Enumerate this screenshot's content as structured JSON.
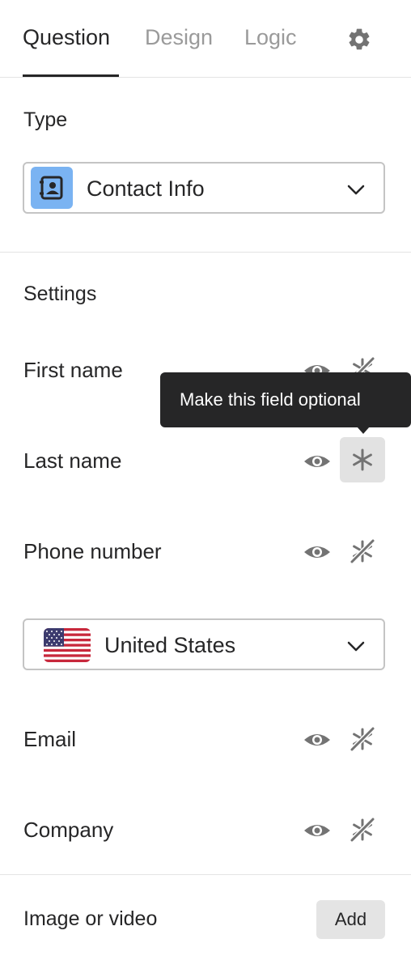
{
  "tabs": [
    {
      "label": "Question",
      "active": true
    },
    {
      "label": "Design",
      "active": false
    },
    {
      "label": "Logic",
      "active": false
    }
  ],
  "type_section": {
    "title": "Type",
    "selected": "Contact Info",
    "icon": "contact-card-icon",
    "icon_color": "#7ab3f2"
  },
  "settings": {
    "title": "Settings",
    "fields": [
      {
        "label": "First name",
        "visible": true,
        "required": false
      },
      {
        "label": "Last name",
        "visible": true,
        "required": true
      },
      {
        "label": "Phone number",
        "visible": true,
        "required": false
      },
      {
        "label": "Email",
        "visible": true,
        "required": false
      },
      {
        "label": "Company",
        "visible": true,
        "required": false
      }
    ],
    "country_select": {
      "value": "United States",
      "icon": "us-flag-icon"
    },
    "tooltip": "Make this field optional"
  },
  "media": {
    "label": "Image or video",
    "add_label": "Add"
  },
  "colors": {
    "text": "#262627",
    "muted": "#9a9a9a",
    "icon": "#737373",
    "accent_blue": "#7ab3f2",
    "tooltip_bg": "#262627"
  }
}
